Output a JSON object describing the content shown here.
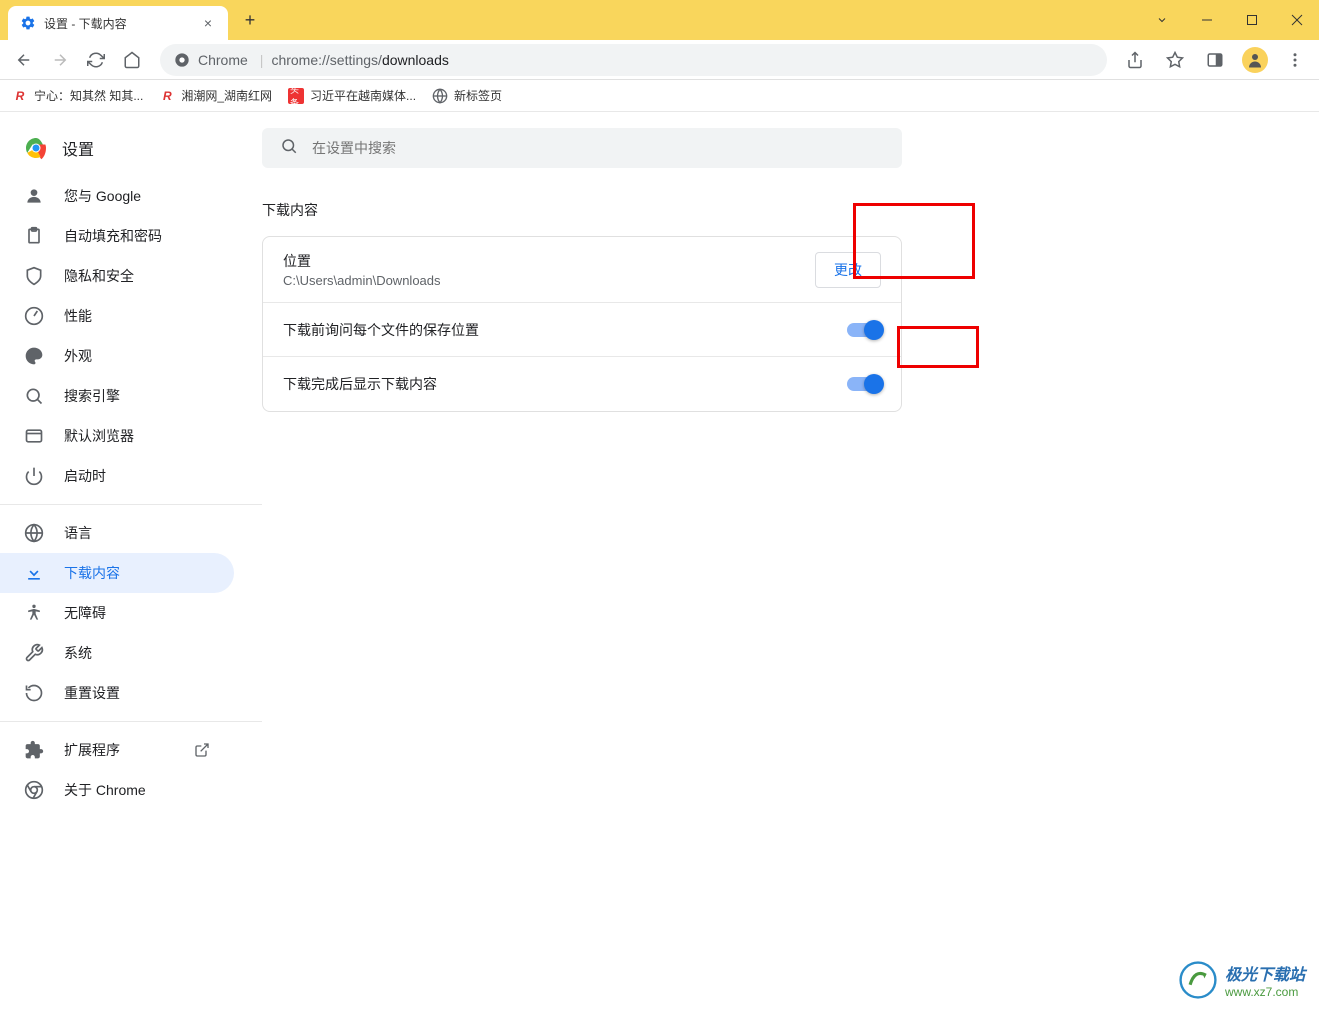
{
  "window": {
    "tab_title": "设置 - 下载内容"
  },
  "address": {
    "protocol_label": "Chrome",
    "url_prefix": "chrome://settings/",
    "url_path": "downloads"
  },
  "bookmarks": [
    {
      "label": "宁心：知其然 知其..."
    },
    {
      "label": "湘潮网_湖南红网"
    },
    {
      "label": "习近平在越南媒体..."
    },
    {
      "label": "新标签页"
    }
  ],
  "sidebar": {
    "title": "设置",
    "items": [
      {
        "label": "您与 Google"
      },
      {
        "label": "自动填充和密码"
      },
      {
        "label": "隐私和安全"
      },
      {
        "label": "性能"
      },
      {
        "label": "外观"
      },
      {
        "label": "搜索引擎"
      },
      {
        "label": "默认浏览器"
      },
      {
        "label": "启动时"
      }
    ],
    "group2": [
      {
        "label": "语言"
      },
      {
        "label": "下载内容"
      },
      {
        "label": "无障碍"
      },
      {
        "label": "系统"
      },
      {
        "label": "重置设置"
      }
    ],
    "group3": [
      {
        "label": "扩展程序"
      },
      {
        "label": "关于 Chrome"
      }
    ]
  },
  "main": {
    "search_placeholder": "在设置中搜索",
    "section_title": "下载内容",
    "location_label": "位置",
    "location_value": "C:\\Users\\admin\\Downloads",
    "change_button": "更改",
    "ask_each_time": "下载前询问每个文件的保存位置",
    "show_after_download": "下载完成后显示下载内容"
  },
  "watermark": {
    "cn": "极光下载站",
    "url": "www.xz7.com"
  }
}
